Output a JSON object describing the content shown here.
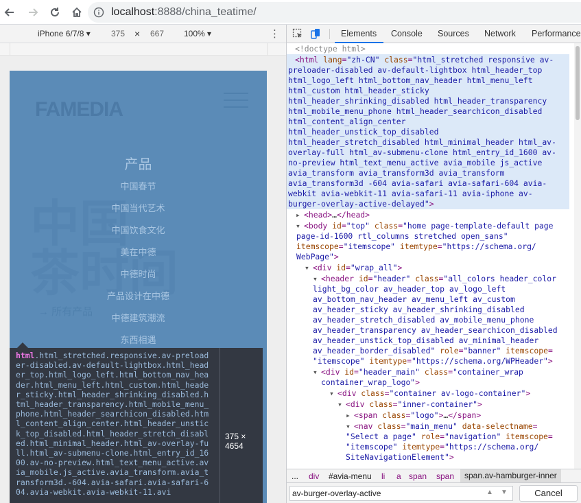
{
  "browser": {
    "url_host": "localhost",
    "url_rest": ":8888/china_teatime/"
  },
  "device_toolbar": {
    "device": "iPhone 6/7/8 ▾",
    "width": "375",
    "times": "×",
    "height": "667",
    "zoom": "100% ▾",
    "more": "⋮"
  },
  "page": {
    "logo": "FAMEDIA",
    "bigtext": "中国\n茶时间",
    "all_products": "→ 所有产品",
    "menu_title": "产品",
    "menu_items": [
      "中国春节",
      "中国当代艺术",
      "中国饮食文化",
      "美在中德",
      "中德时尚",
      "产品设计在中德",
      "中德建筑潮流",
      "东西相遇"
    ]
  },
  "tooltip": {
    "tag": "html",
    "selector": ".html_stretched.responsive.av-preloader-disabled.av-default-lightbox.html_header_top.html_logo_left.html_bottom_nav_header.html_menu_left.html_custom.html_header_sticky.html_header_shrinking_disabled.html_header_transparency.html_mobile_menu_phone.html_header_searchicon_disabled.html_content_align_center.html_header_unstick_top_disabled.html_header_stretch_disabled.html_minimal_header.html_av-overlay-full.html_av-submenu-clone.html_entry_id_1600.av-no-preview.html_text_menu_active.avia_mobile.js_active.avia_transform.avia_transform3d.-604.avia-safari.avia-safari-604.avia-webkit.avia-webkit-11.avi",
    "size": "375 × 4654"
  },
  "devtools": {
    "tabs": [
      "Elements",
      "Console",
      "Sources",
      "Network",
      "Performance"
    ],
    "active_tab": "Elements",
    "breadcrumbs": [
      "...",
      "div",
      "#avia-menu",
      "li",
      "a",
      "span",
      "span",
      "span.av-hamburger-inner"
    ],
    "search_value": "av-burger-overlay-active",
    "cancel_label": "Cancel"
  },
  "colors": {
    "page_bg": "#5b8bb7",
    "highlight": "#dce9f8",
    "tag": "#881280",
    "attr_name": "#994500",
    "attr_value": "#1a1aa6"
  }
}
